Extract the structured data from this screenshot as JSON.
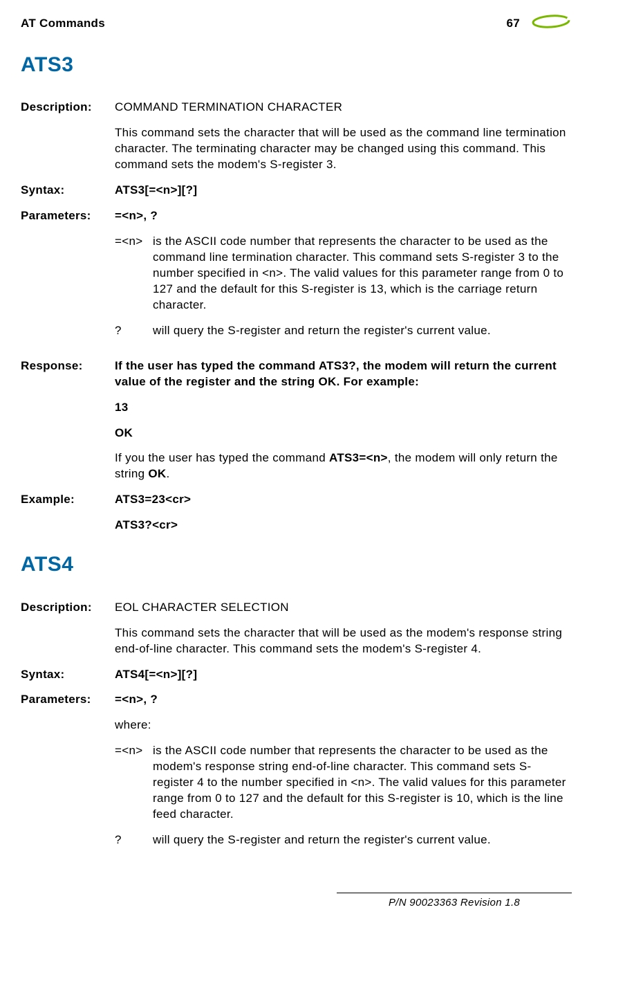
{
  "header": {
    "left": "AT Commands",
    "page": "67"
  },
  "ats3": {
    "title": "ATS3",
    "desc_label": "Description:",
    "desc_title": "COMMAND TERMINATION CHARACTER",
    "desc_body": "This command sets the character that will be used as the command line termination character. The terminating character may be changed using this command. This command sets the modem's S-register 3.",
    "syntax_label": "Syntax:",
    "syntax_val": "ATS3[=<n>][?]",
    "params_label": "Parameters:",
    "params_val": "=<n>, ?",
    "param1_key": "=<n>",
    "param1_val": "is the ASCII code number that represents the character to be used as the command line termination character. This command sets S-register 3 to the number specified in <n>. The valid values for this parameter range from 0 to 127 and the default for this S-register is 13, which is the carriage return character.",
    "param2_key": "?",
    "param2_val": "will query the S-register and return the register's current value.",
    "response_label": "Response:",
    "response_1": "If the user has typed the command ATS3?, the modem will return the current value of the register and the string OK. For example:",
    "response_2": "13",
    "response_3": "OK",
    "response_4a": "If you the user has typed the command ",
    "response_4b": "ATS3=<n>",
    "response_4c": ", the modem will only return the string ",
    "response_4d": "OK",
    "response_4e": ".",
    "example_label": "Example:",
    "example_1": "ATS3=23<cr>",
    "example_2": "ATS3?<cr>"
  },
  "ats4": {
    "title": "ATS4",
    "desc_label": "Description:",
    "desc_title": "EOL CHARACTER SELECTION",
    "desc_body": "This command sets the character that will be used as the modem's response string end-of-line character. This command sets the modem's S-register 4.",
    "syntax_label": "Syntax:",
    "syntax_val": "ATS4[=<n>][?]",
    "params_label": "Parameters:",
    "params_val": "=<n>, ?",
    "where": "where:",
    "param1_key": "=<n>",
    "param1_val": "is the ASCII code number that represents the character to be used as the modem's response string end-of-line character. This command sets S-register 4 to the number specified in <n>. The valid values for this parameter range from 0 to 127 and the default for this S-register is 10, which is the line feed character.",
    "param2_key": "?",
    "param2_val": "will query the S-register and return the register's current value."
  },
  "footer": "P/N 90023363  Revision 1.8"
}
